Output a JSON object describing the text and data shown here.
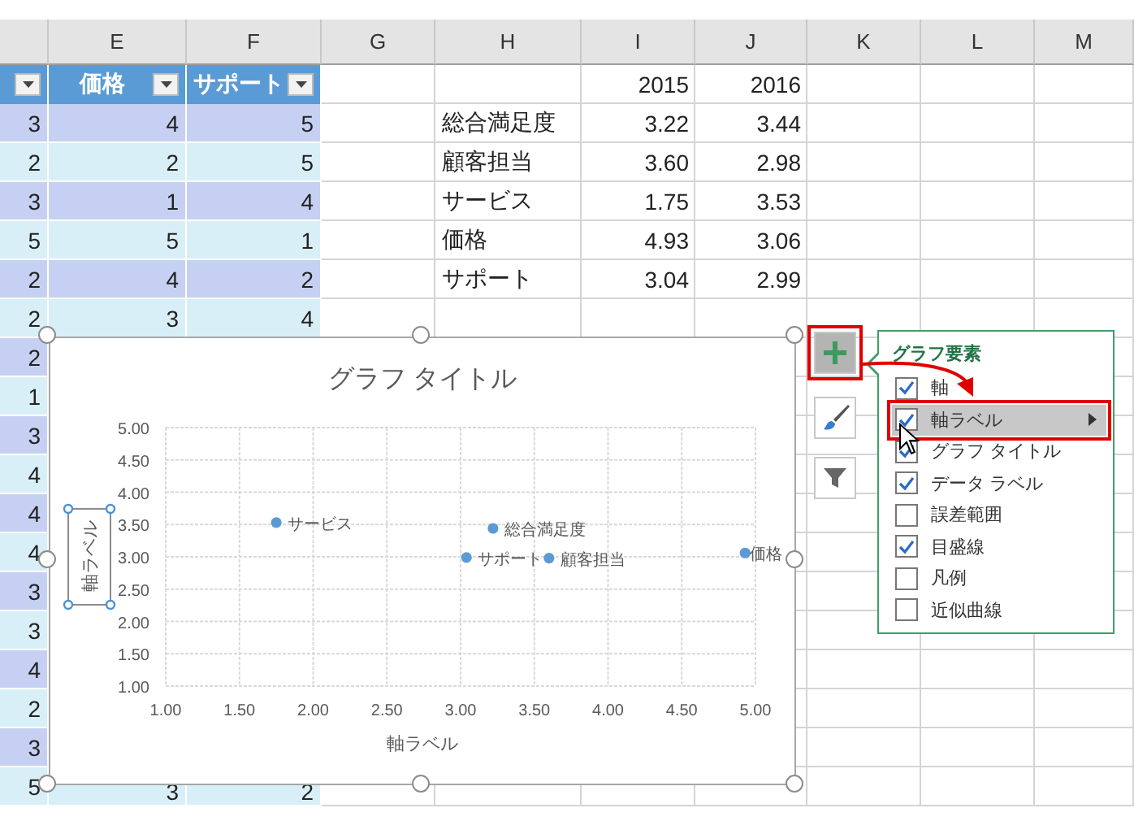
{
  "column_headers": [
    "E",
    "F",
    "G",
    "H",
    "I",
    "J",
    "K",
    "L",
    "M"
  ],
  "left_table": {
    "header": [
      {
        "filter": true
      },
      {
        "label": "価格",
        "filter": true
      },
      {
        "label": "サポート",
        "filter": true
      }
    ],
    "rows": [
      [
        "3",
        "4",
        "5"
      ],
      [
        "2",
        "2",
        "5"
      ],
      [
        "3",
        "1",
        "4"
      ],
      [
        "5",
        "5",
        "1"
      ],
      [
        "2",
        "4",
        "2"
      ],
      [
        "2",
        "3",
        "4"
      ],
      [
        "2"
      ],
      [
        "1"
      ],
      [
        "3"
      ],
      [
        "4"
      ],
      [
        "4"
      ],
      [
        "4"
      ],
      [
        "3"
      ],
      [
        "3"
      ],
      [
        "4"
      ],
      [
        "2"
      ],
      [
        "3"
      ],
      [
        "5",
        "3",
        "2"
      ]
    ]
  },
  "right_table": {
    "header": [
      "2015",
      "2016"
    ],
    "rows": [
      [
        "総合満足度",
        "3.22",
        "3.44"
      ],
      [
        "顧客担当",
        "3.60",
        "2.98"
      ],
      [
        "サービス",
        "1.75",
        "3.53"
      ],
      [
        "価格",
        "4.93",
        "3.06"
      ],
      [
        "サポート",
        "3.04",
        "2.99"
      ]
    ]
  },
  "chart": {
    "ylabel_selected": true,
    "chart_data": {
      "type": "scatter",
      "title": "グラフ タイトル",
      "xlabel": "軸ラベル",
      "ylabel": "軸ラベル",
      "grid": true,
      "series": [
        {
          "color": "#5b9bd5",
          "x": [
            3.22,
            3.6,
            1.75,
            4.93,
            3.04
          ],
          "values": [
            3.44,
            2.98,
            3.53,
            3.06,
            2.99
          ]
        }
      ],
      "value_labels": [
        "総合満足度",
        "顧客担当",
        "サービス",
        "価格",
        "サポート"
      ],
      "xlim": [
        1,
        5
      ],
      "ylim": [
        1,
        5
      ],
      "xticks": [
        {
          "value": 1,
          "label": "1.00"
        },
        {
          "value": 1.5,
          "label": "1.50"
        },
        {
          "value": 2,
          "label": "2.00"
        },
        {
          "value": 2.5,
          "label": "2.50"
        },
        {
          "value": 3,
          "label": "3.00"
        },
        {
          "value": 3.5,
          "label": "3.50"
        },
        {
          "value": 4,
          "label": "4.00"
        },
        {
          "value": 4.5,
          "label": "4.50"
        },
        {
          "value": 5,
          "label": "5.00"
        }
      ],
      "yticks": [
        {
          "value": 1,
          "label": "1.00"
        },
        {
          "value": 1.5,
          "label": "1.50"
        },
        {
          "value": 2,
          "label": "2.00"
        },
        {
          "value": 2.5,
          "label": "2.50"
        },
        {
          "value": 3,
          "label": "3.00"
        },
        {
          "value": 3.5,
          "label": "3.50"
        },
        {
          "value": 4,
          "label": "4.00"
        },
        {
          "value": 4.5,
          "label": "4.50"
        },
        {
          "value": 5,
          "label": "5.00"
        }
      ]
    }
  },
  "chart_buttons": [
    {
      "kind": "elements",
      "selected": true,
      "highlighted": true
    },
    {
      "kind": "styles",
      "selected": false,
      "highlighted": false
    },
    {
      "kind": "filters",
      "selected": false,
      "highlighted": false
    }
  ],
  "chart_elements_panel": {
    "title": "グラフ要素",
    "items": [
      {
        "label": "軸",
        "checked": true,
        "hovered": false,
        "highlighted": false
      },
      {
        "label": "軸ラベル",
        "checked": true,
        "hovered": true,
        "highlighted": true
      },
      {
        "label": "グラフ タイトル",
        "checked": true,
        "hovered": false,
        "highlighted": false
      },
      {
        "label": "データ ラベル",
        "checked": true,
        "hovered": false,
        "highlighted": false
      },
      {
        "label": "誤差範囲",
        "checked": false,
        "hovered": false,
        "highlighted": false
      },
      {
        "label": "目盛線",
        "checked": true,
        "hovered": false,
        "highlighted": false
      },
      {
        "label": "凡例",
        "checked": false,
        "hovered": false,
        "highlighted": false
      },
      {
        "label": "近似曲線",
        "checked": false,
        "hovered": false,
        "highlighted": false
      }
    ]
  }
}
